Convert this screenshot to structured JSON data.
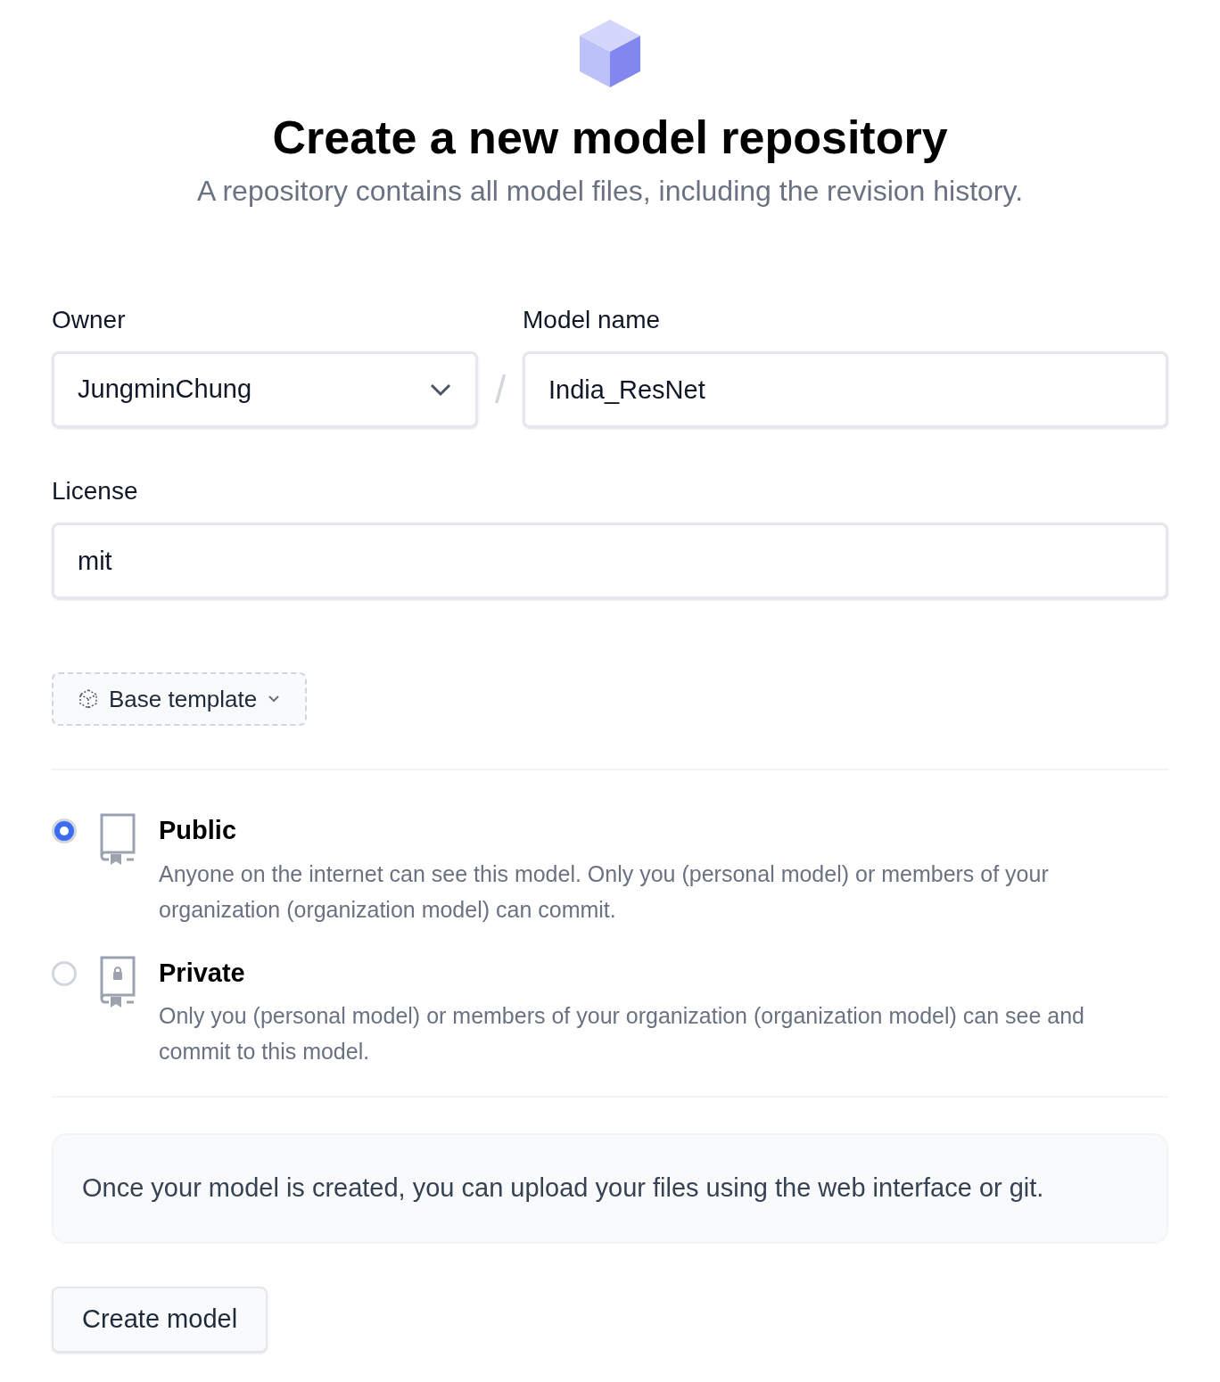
{
  "header": {
    "title": "Create a new model repository",
    "subtitle": "A repository contains all model files, including the revision history."
  },
  "owner": {
    "label": "Owner",
    "value": "JungminChung"
  },
  "separator": "/",
  "model_name": {
    "label": "Model name",
    "value": "India_ResNet"
  },
  "license": {
    "label": "License",
    "value": "mit"
  },
  "template_button": {
    "label": "Base template"
  },
  "visibility": [
    {
      "kind": "public",
      "selected": true,
      "title": "Public",
      "description": "Anyone on the internet can see this model. Only you (personal model) or members of your organization (organization model) can commit."
    },
    {
      "kind": "private",
      "selected": false,
      "title": "Private",
      "description": "Only you (personal model) or members of your organization (organization model) can see and commit to this model."
    }
  ],
  "notice": "Once your model is created, you can upload your files using the web interface or git.",
  "submit_button": "Create model"
}
